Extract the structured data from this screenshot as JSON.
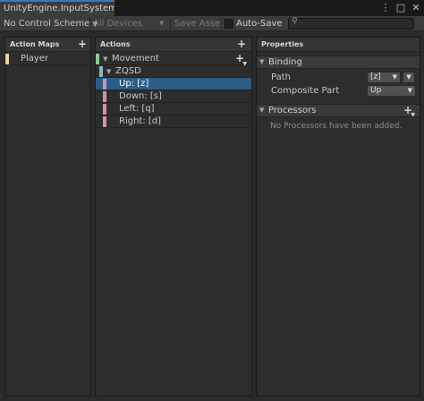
{
  "window": {
    "tab_title": "UnityEngine.InputSystem....",
    "menu_icon": "kebab-menu-icon",
    "maximize_icon": "maximize-icon",
    "close_icon": "close-icon"
  },
  "toolbar": {
    "control_scheme": "No Control Scheme",
    "devices": "All Devices",
    "save_asset": "Save Asset",
    "auto_save_label": "Auto-Save",
    "auto_save_checked": false,
    "search_placeholder": "",
    "search_icon": "search-icon"
  },
  "action_maps": {
    "header": "Action Maps",
    "items": [
      {
        "label": "Player",
        "color": "#e8d68a"
      }
    ]
  },
  "actions": {
    "header": "Actions",
    "action": {
      "label": "Movement",
      "color": "#8dc88d"
    },
    "composite": {
      "label": "ZQSD",
      "color": "#8ab4c8"
    },
    "bindings": [
      {
        "label": "Up: [z]",
        "color": "#d58fb6",
        "selected": true
      },
      {
        "label": "Down: [s]",
        "color": "#d58fb6",
        "selected": false
      },
      {
        "label": "Left: [q]",
        "color": "#d58fb6",
        "selected": false
      },
      {
        "label": "Right: [d]",
        "color": "#d58fb6",
        "selected": false
      }
    ]
  },
  "properties": {
    "header": "Properties",
    "binding_section": "Binding",
    "path_label": "Path",
    "path_value": "[z]",
    "part_label": "Composite Part",
    "part_value": "Up",
    "processors_section": "Processors",
    "processors_empty": "No Processors have been added."
  },
  "colors": {
    "accent": "#3a79bb",
    "selection": "#2c5d87"
  }
}
